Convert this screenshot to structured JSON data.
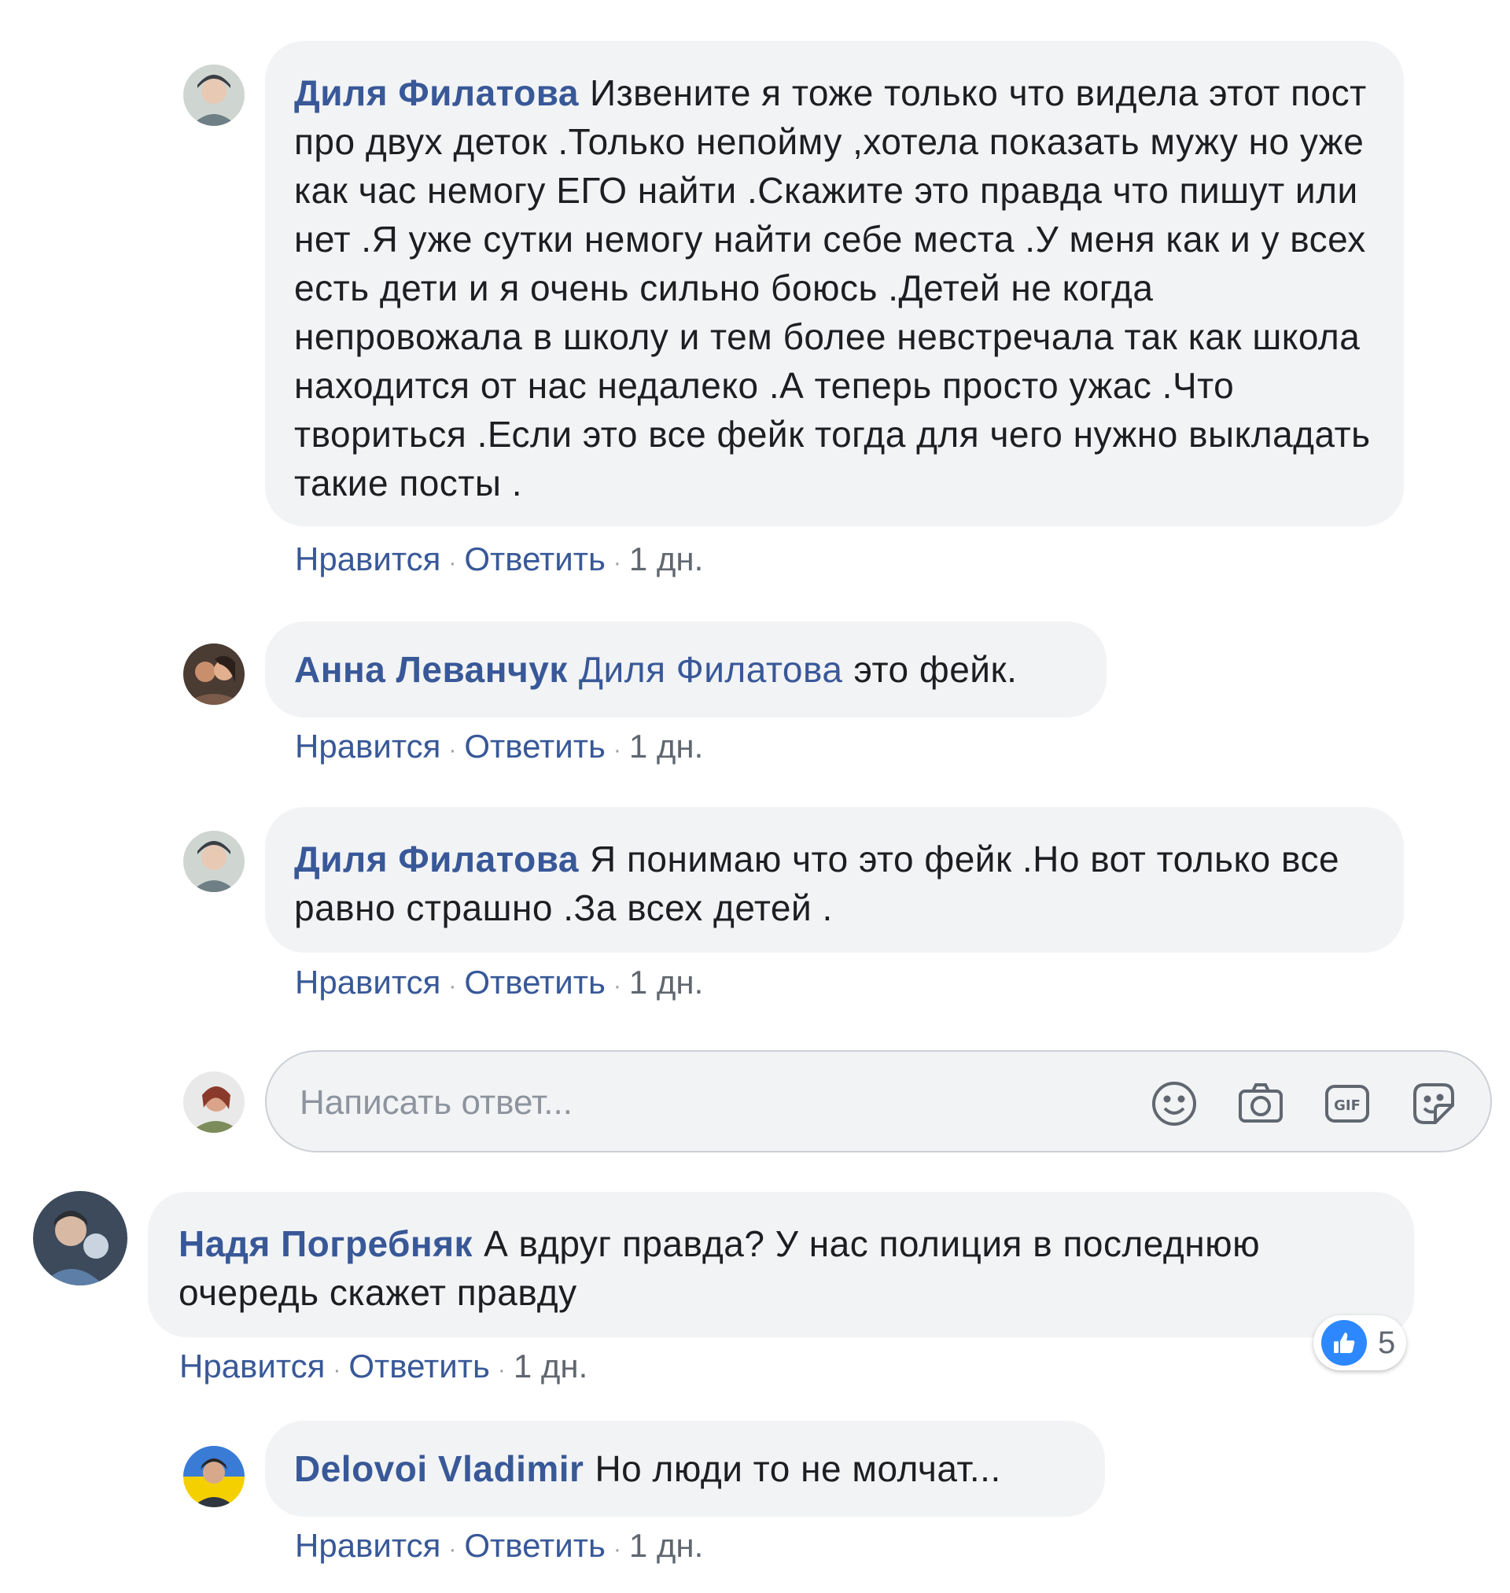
{
  "comments": [
    {
      "author": "Диля Филатова",
      "mention": "",
      "text": "Извените я тоже только что видела этот пост про двух деток .Только непойму ,хотела показать мужу но уже как час немогу ЕГО найти .Скажите это правда что пишут или нет .Я уже сутки немогу найти себе места .У меня как и у всех есть дети и я очень сильно боюсь .Детей не когда непровожала в школу и тем более невстречала так как школа находится от нас недалеко .А теперь просто ужас .Что твориться .Если это все фейк тогда для чего нужно выкладать такие посты .",
      "like": "Нравится",
      "reply": "Ответить",
      "time": "1 дн."
    },
    {
      "author": "Анна Леванчук",
      "mention": "Диля Филатова",
      "text": "это фейк.",
      "like": "Нравится",
      "reply": "Ответить",
      "time": "1 дн."
    },
    {
      "author": "Диля Филатова",
      "mention": "",
      "text": "Я понимаю что это фейк .Но вот только все равно страшно .За всех детей .",
      "like": "Нравится",
      "reply": "Ответить",
      "time": "1 дн."
    },
    {
      "author": "Надя Погребняк",
      "mention": "",
      "text": "А вдруг правда? У нас полиция в последнюю очередь скажет правду",
      "like": "Нравится",
      "reply": "Ответить",
      "time": "1 дн.",
      "reactions": {
        "icon": "thumbs-up-icon",
        "count": "5"
      }
    },
    {
      "author": "Delovoi Vladimir",
      "mention": "",
      "text": "Но люди то не молчат...",
      "like": "Нравится",
      "reply": "Ответить",
      "time": "1 дн."
    }
  ],
  "reply_box": {
    "placeholder": "Написать ответ...",
    "icons": [
      "emoji-icon",
      "camera-icon",
      "gif-icon",
      "sticker-icon"
    ]
  },
  "colors": {
    "author": "#385898",
    "bubble": "#f2f3f5",
    "meta": "#606770",
    "like_blue": "#2d88ff"
  }
}
